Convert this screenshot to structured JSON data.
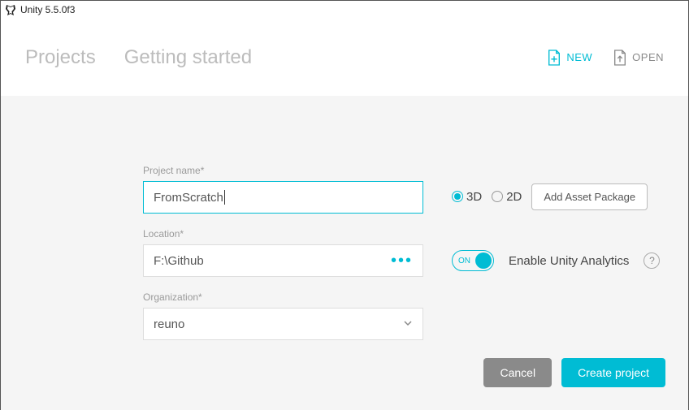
{
  "window": {
    "title": "Unity 5.5.0f3"
  },
  "tabs": {
    "projects": "Projects",
    "getting_started": "Getting started"
  },
  "header": {
    "new": "NEW",
    "open": "OPEN"
  },
  "form": {
    "project_name_label": "Project name*",
    "project_name_value": "FromScratch",
    "location_label": "Location*",
    "location_value": "F:\\Github",
    "organization_label": "Organization*",
    "organization_value": "reuno"
  },
  "options": {
    "mode_3d": "3D",
    "mode_2d": "2D",
    "add_asset_package": "Add Asset Package",
    "toggle_on": "ON",
    "analytics_label": "Enable Unity Analytics"
  },
  "buttons": {
    "cancel": "Cancel",
    "create": "Create project"
  }
}
